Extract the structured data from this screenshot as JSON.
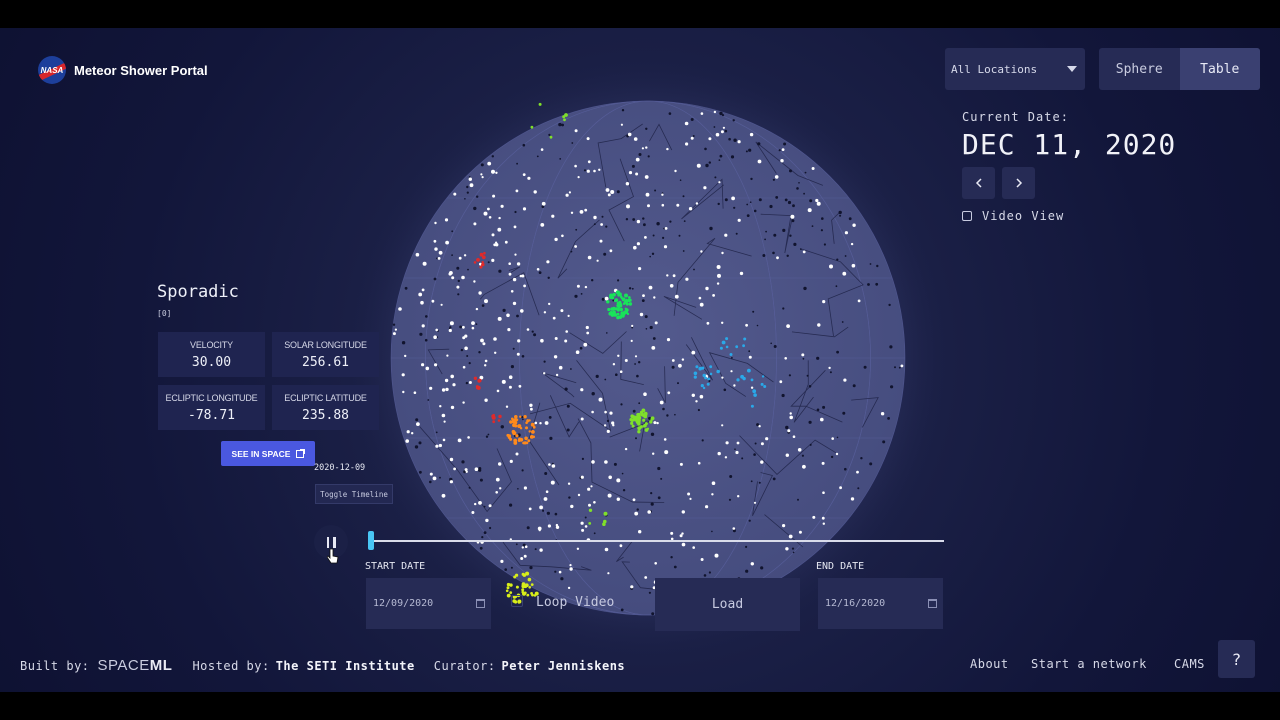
{
  "header": {
    "logo_text": "NASA",
    "title": "Meteor Shower Portal",
    "location_select": "All Locations",
    "view_options": [
      "Sphere",
      "Table"
    ],
    "active_view": "Table"
  },
  "date_panel": {
    "label": "Current Date:",
    "value": "DEC 11, 2020",
    "prev_icon": "chevron-left-icon",
    "next_icon": "chevron-right-icon",
    "video_view_label": "Video View",
    "video_view_checked": false
  },
  "shower": {
    "name": "Sporadic",
    "code": "[0]",
    "stats": [
      {
        "title": "VELOCITY",
        "value": "30.00"
      },
      {
        "title": "SOLAR LONGITUDE",
        "value": "256.61"
      },
      {
        "title": "ECLIPTIC LONGITUDE",
        "value": "-78.71"
      },
      {
        "title": "ECLIPTIC LATITUDE",
        "value": "235.88"
      }
    ],
    "see_in_space": "SEE IN SPACE"
  },
  "timeline": {
    "current_date": "2020-12-09",
    "toggle_label": "Toggle Timeline",
    "progress": 0.005,
    "start_label": "START DATE",
    "start_value": "12/09/2020",
    "end_label": "END DATE",
    "end_value": "12/16/2020",
    "loop_label": "Loop Video",
    "load_label": "Load"
  },
  "sphere_colors": {
    "background": "#4b5285",
    "stars": "#ffffff",
    "clusters": [
      "#19e35a",
      "#7fe02a",
      "#ff8a1c",
      "#2aa8e8",
      "#d8ee1a",
      "#e02a2a"
    ]
  },
  "footer": {
    "built_by_label": "Built by:",
    "built_by_logo": "SPACEML",
    "hosted_by_label": "Hosted by:",
    "hosted_by": "The SETI Institute",
    "curator_label": "Curator:",
    "curator": "Peter Jenniskens",
    "links": [
      "About",
      "Start a network",
      "CAMS"
    ],
    "help": "?"
  }
}
